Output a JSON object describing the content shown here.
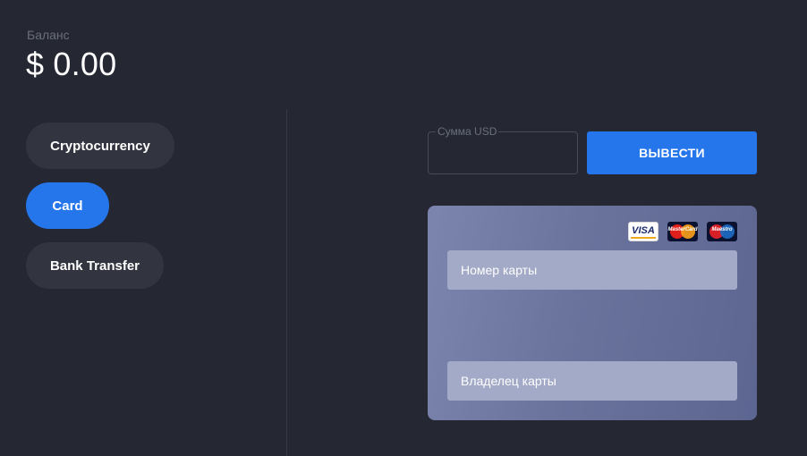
{
  "balance": {
    "label": "Баланс",
    "value": "$ 0.00"
  },
  "payment_methods": [
    {
      "label": "Cryptocurrency",
      "active": false
    },
    {
      "label": "Card",
      "active": true
    },
    {
      "label": "Bank Transfer",
      "active": false
    }
  ],
  "withdraw_form": {
    "amount_label": "Сумма USD",
    "amount_value": "",
    "submit_label": "ВЫВЕСТИ"
  },
  "card_form": {
    "logos": [
      {
        "name": "visa-logo",
        "text": "VISA"
      },
      {
        "name": "mastercard-logo",
        "text": "MasterCard"
      },
      {
        "name": "maestro-logo",
        "text": "Maestro"
      }
    ],
    "card_number_placeholder": "Номер карты",
    "card_holder_placeholder": "Владелец карты"
  },
  "colors": {
    "background": "#252733",
    "accent": "#2576ea",
    "inactive_pill": "#32343f",
    "card_panel": "#6a739c"
  }
}
